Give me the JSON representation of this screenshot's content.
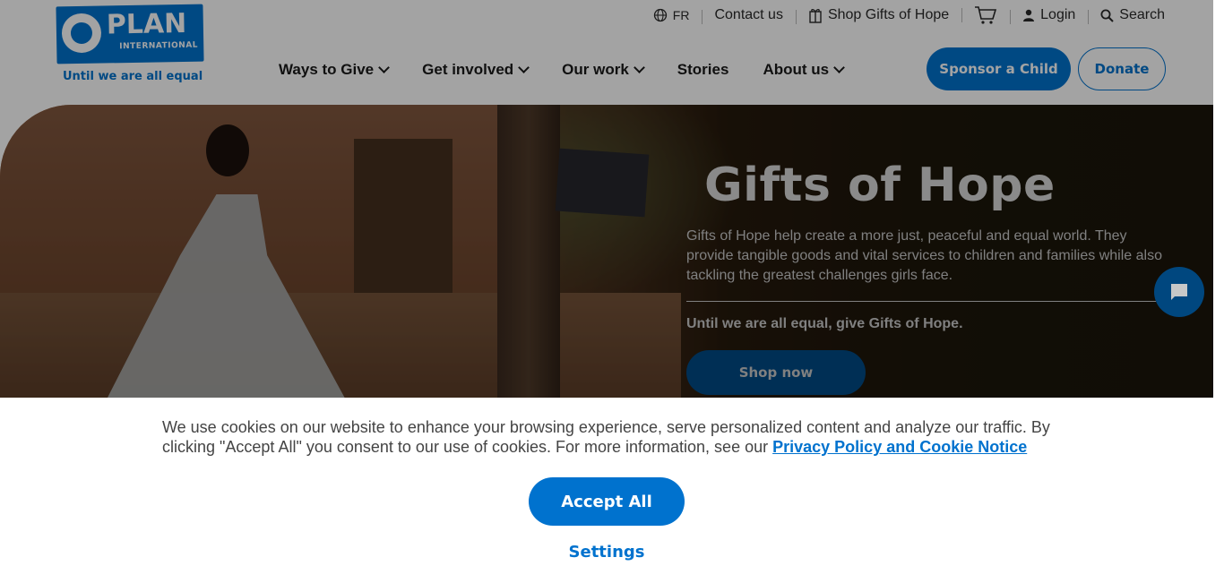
{
  "logo": {
    "wordmark": "PLAN",
    "sub": "INTERNATIONAL",
    "tagline": "Until we are all equal"
  },
  "utility": {
    "language": "FR",
    "contact": "Contact us",
    "shop": "Shop Gifts of Hope",
    "login": "Login",
    "search": "Search"
  },
  "nav": {
    "items": [
      {
        "label": "Ways to Give",
        "dropdown": true
      },
      {
        "label": "Get involved",
        "dropdown": true
      },
      {
        "label": "Our work",
        "dropdown": true
      },
      {
        "label": "Stories",
        "dropdown": false
      },
      {
        "label": "About us",
        "dropdown": true
      }
    ],
    "sponsor": "Sponsor a Child",
    "donate": "Donate"
  },
  "hero": {
    "title": "Gifts of Hope",
    "description": "Gifts of Hope help create a more just, peaceful and equal world. They provide tangible goods and vital services to children and families while also tackling the greatest challenges girls face.",
    "cta_text": "Until we are all equal, give Gifts of Hope.",
    "button": "Shop now"
  },
  "cookie": {
    "text": "We use cookies on our website to enhance your browsing experience, serve personalized content and analyze our traffic. By clicking \"Accept All\" you consent to our use of cookies. For more information, see our",
    "link": "Privacy Policy and Cookie Notice",
    "accept": "Accept All",
    "settings": "Settings"
  },
  "colors": {
    "brand": "#0072ce",
    "dark_brand": "#00477f"
  }
}
